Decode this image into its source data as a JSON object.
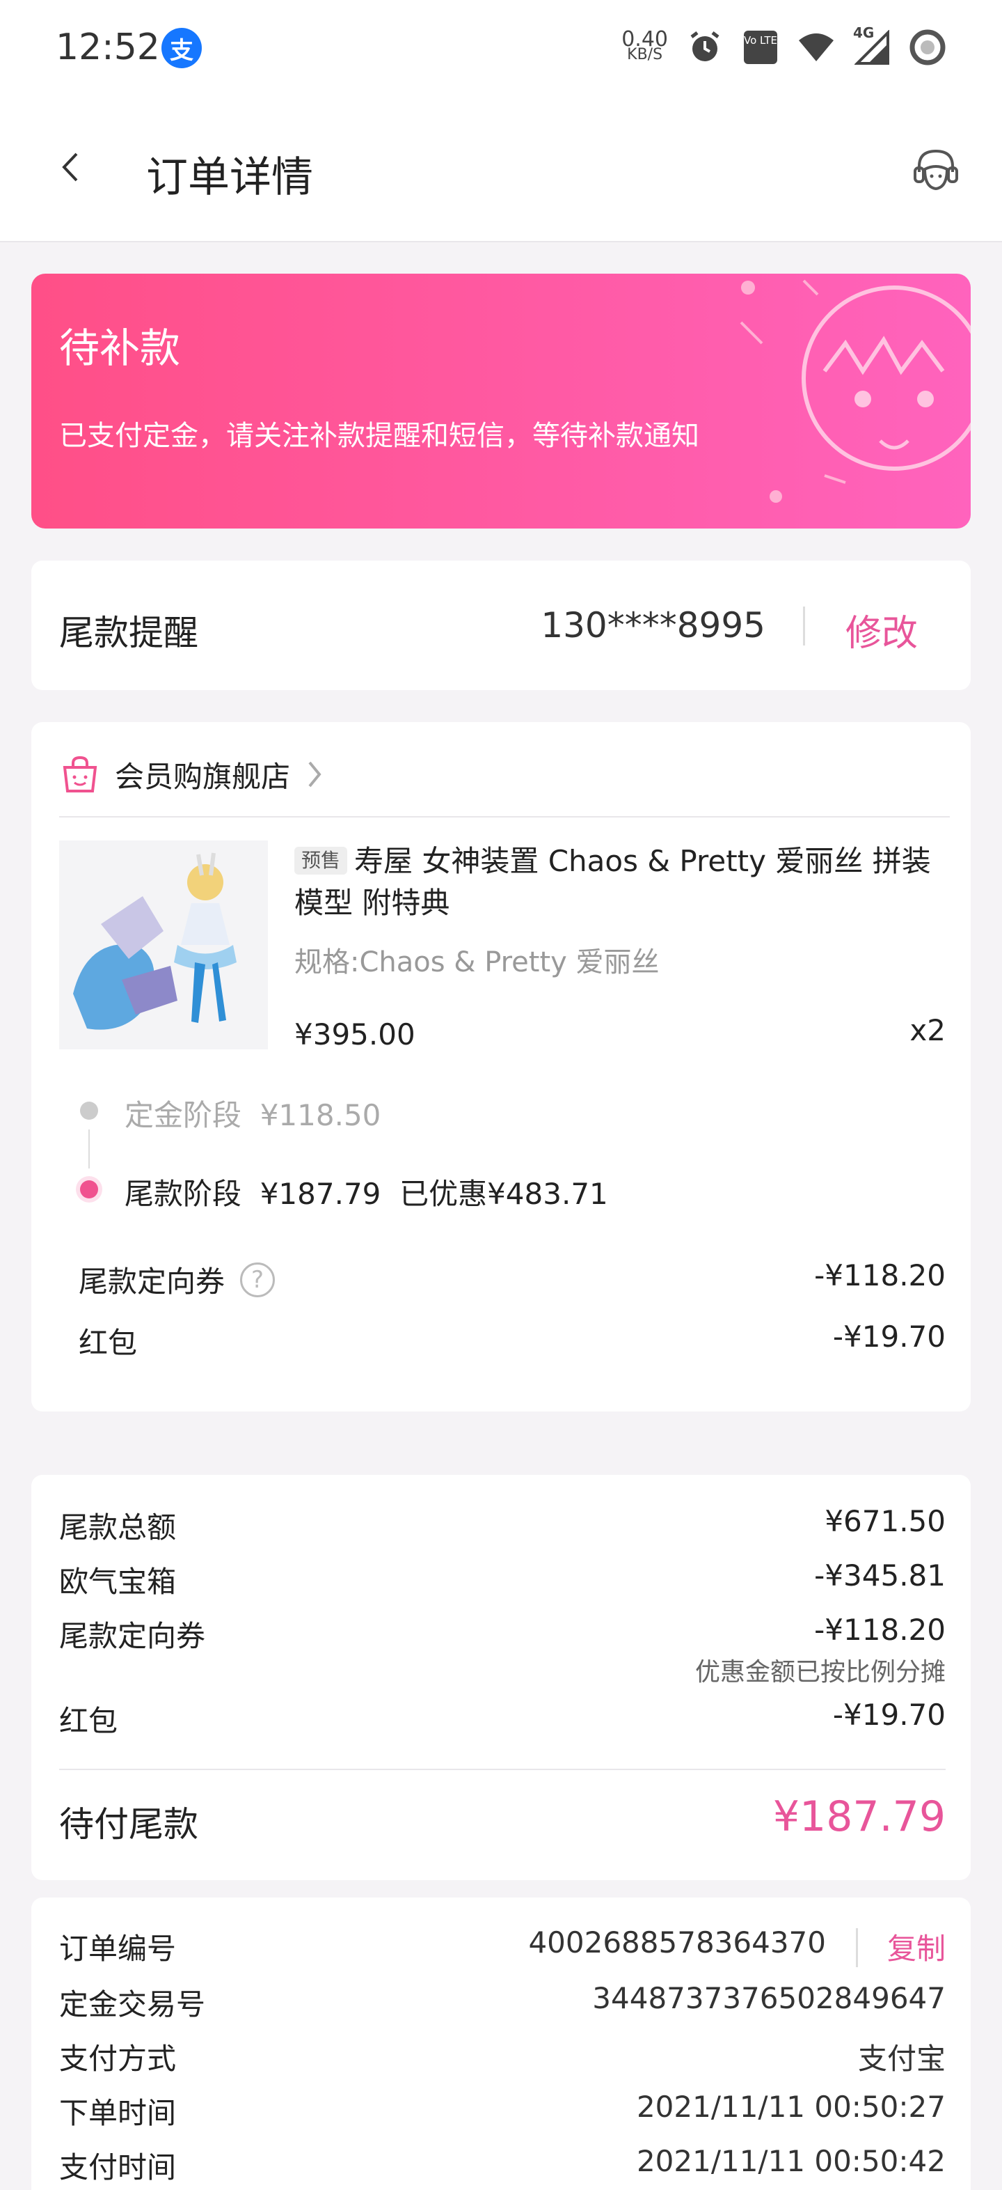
{
  "status_bar": {
    "time": "12:52",
    "app_badge": "支",
    "net_speed_value": "0.40",
    "net_speed_unit": "KB/S",
    "volte_label": "Vo LTE",
    "network_label": "4G"
  },
  "nav": {
    "title": "订单详情"
  },
  "banner": {
    "title": "待补款",
    "description": "已支付定金，请关注补款提醒和短信，等待补款通知"
  },
  "reminder": {
    "label": "尾款提醒",
    "phone": "130****8995",
    "modify_label": "修改"
  },
  "order": {
    "store_name": "会员购旗舰店",
    "presale_tag": "预售",
    "product_title": "寿屋 女神装置 Chaos & Pretty 爱丽丝 拼装模型 附特典",
    "spec": "规格:Chaos & Pretty 爱丽丝",
    "price": "¥395.00",
    "quantity": "x2",
    "deposit_stage": "定金阶段  ¥118.50",
    "balance_stage": "尾款阶段  ¥187.79  已优惠¥483.71",
    "discounts": [
      {
        "label": "尾款定向券",
        "value": "-¥118.20"
      },
      {
        "label": "红包",
        "value": "-¥19.70"
      }
    ]
  },
  "summary": {
    "rows": [
      {
        "label": "尾款总额",
        "value": "¥671.50"
      },
      {
        "label": "欧气宝箱",
        "value": "-¥345.81"
      },
      {
        "label": "尾款定向券",
        "value": "-¥118.20",
        "note": "优惠金额已按比例分摊"
      },
      {
        "label": "红包",
        "value": "-¥19.70"
      }
    ],
    "due_label": "待付尾款",
    "due_value": "¥187.79"
  },
  "info": {
    "copy_label": "复制",
    "rows": [
      {
        "label": "订单编号",
        "value": "4002688578364370"
      },
      {
        "label": "定金交易号",
        "value": "3448737376502849647"
      },
      {
        "label": "支付方式",
        "value": "支付宝"
      },
      {
        "label": "下单时间",
        "value": "2021/11/11 00:50:27"
      },
      {
        "label": "支付时间",
        "value": "2021/11/11 00:50:42"
      }
    ]
  },
  "colors": {
    "accent": "#e8559a",
    "banner_start": "#ff4f87",
    "banner_end": "#ff63bd"
  }
}
